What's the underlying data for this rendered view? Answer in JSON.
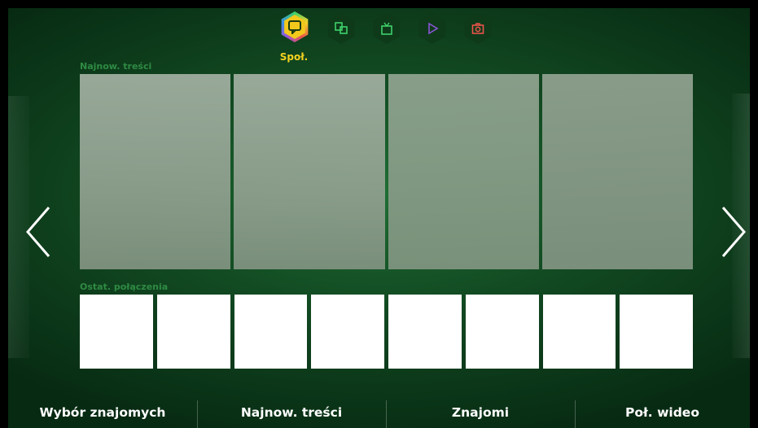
{
  "hub": {
    "active_label": "Społ.",
    "icons": [
      {
        "name": "social-icon",
        "color": "#f2c81c",
        "active": true
      },
      {
        "name": "apps-icon",
        "color": "#3fd06a",
        "active": false
      },
      {
        "name": "tv-icon",
        "color": "#3fd06a",
        "active": false
      },
      {
        "name": "play-icon",
        "color": "#8a55d6",
        "active": false
      },
      {
        "name": "camera-icon",
        "color": "#e9544a",
        "active": false
      }
    ]
  },
  "sections": {
    "recent_content_label": "Najnow. treści",
    "recent_calls_label": "Ostat. połączenia"
  },
  "bottom_menu": {
    "items": [
      "Wybór znajomych",
      "Najnow. treści",
      "Znajomi",
      "Poł. wideo"
    ]
  },
  "colors": {
    "accent": "#f5d21e",
    "section_label": "#2f8a43",
    "background": "#124a22"
  }
}
